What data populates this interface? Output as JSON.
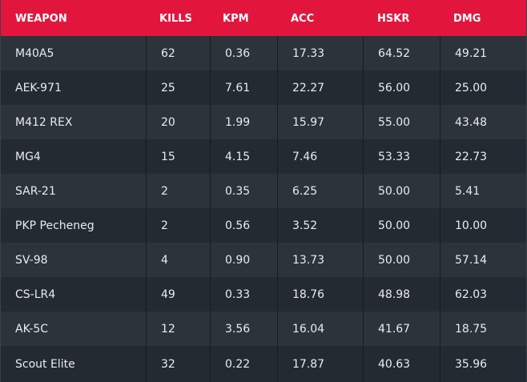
{
  "columns": [
    "WEAPON",
    "KILLS",
    "KPM",
    "ACC",
    "HSKR",
    "DMG"
  ],
  "rows": [
    [
      "M40A5",
      "62",
      "0.36",
      "17.33",
      "64.52",
      "49.21"
    ],
    [
      "AEK-971",
      "25",
      "7.61",
      "22.27",
      "56.00",
      "25.00"
    ],
    [
      "M412 REX",
      "20",
      "1.99",
      "15.97",
      "55.00",
      "43.48"
    ],
    [
      "MG4",
      "15",
      "4.15",
      "7.46",
      "53.33",
      "22.73"
    ],
    [
      "SAR-21",
      "2",
      "0.35",
      "6.25",
      "50.00",
      "5.41"
    ],
    [
      "PKP Pecheneg",
      "2",
      "0.56",
      "3.52",
      "50.00",
      "10.00"
    ],
    [
      "SV-98",
      "4",
      "0.90",
      "13.73",
      "50.00",
      "57.14"
    ],
    [
      "CS-LR4",
      "49",
      "0.33",
      "18.76",
      "48.98",
      "62.03"
    ],
    [
      "AK-5C",
      "12",
      "3.56",
      "16.04",
      "41.67",
      "18.75"
    ],
    [
      "Scout Elite",
      "32",
      "0.22",
      "17.87",
      "40.63",
      "35.96"
    ]
  ],
  "colors": {
    "header_bg": "#e2163d",
    "row_bg_dark": "#232a31",
    "row_bg_light": "#2c333a",
    "text": "#e8ecef"
  }
}
